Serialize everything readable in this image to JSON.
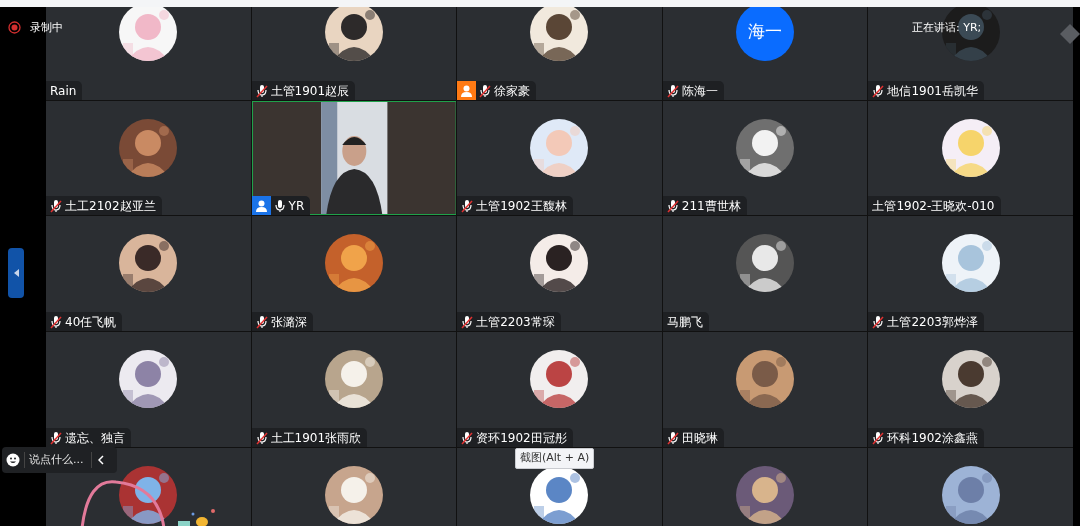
{
  "recording": {
    "label": "录制中"
  },
  "speaking": {
    "label": "正在讲话: YR;"
  },
  "rows": [
    {
      "tiles": [
        {
          "name": "Rain",
          "kind": "picture",
          "speaking": false
        },
        {
          "name": "土管1901赵辰",
          "muted": true,
          "kind": "picture",
          "speaking": false
        },
        {
          "name": "徐家豪",
          "muted": true,
          "kind": "picture",
          "color": "#ff7a14",
          "speaking": false
        },
        {
          "name": "陈海一",
          "muted": true,
          "kind": "initials",
          "initials": "海一",
          "speaking": false
        },
        {
          "name": "地信1901岳凯华",
          "muted": true,
          "kind": "picture",
          "speaking": false
        }
      ]
    },
    {
      "tiles": [
        {
          "name": "土工2102赵亚兰",
          "muted": true,
          "kind": "picture",
          "speaking": false
        },
        {
          "name": "YR",
          "muted": false,
          "kind": "video",
          "color": "#1a73e8",
          "speaking": true
        },
        {
          "name": "土管1902王馥林",
          "muted": true,
          "kind": "picture",
          "speaking": false
        },
        {
          "name": "211曹世林",
          "muted": true,
          "kind": "picture",
          "speaking": false
        },
        {
          "name": "土管1902-王晓欢-010",
          "kind": "picture",
          "speaking": false
        }
      ]
    },
    {
      "tiles": [
        {
          "name": "40任飞帆",
          "muted": true,
          "kind": "picture",
          "speaking": false
        },
        {
          "name": "张潞深",
          "muted": true,
          "kind": "picture",
          "speaking": false
        },
        {
          "name": "土管2203常琛",
          "muted": true,
          "kind": "picture",
          "speaking": false
        },
        {
          "name": "马鹏飞",
          "kind": "picture",
          "speaking": false
        },
        {
          "name": "土管2203郭烨泽",
          "muted": true,
          "kind": "picture",
          "speaking": false
        }
      ]
    },
    {
      "tiles": [
        {
          "name": "遗忘、独言",
          "muted": true,
          "kind": "picture",
          "speaking": false
        },
        {
          "name": "土工1901张雨欣",
          "muted": true,
          "kind": "picture",
          "speaking": false
        },
        {
          "name": "资环1902田冠彤",
          "muted": true,
          "kind": "picture",
          "speaking": false
        },
        {
          "name": "田晓琳",
          "muted": true,
          "kind": "picture",
          "speaking": false
        },
        {
          "name": "环科1902涂鑫燕",
          "muted": true,
          "kind": "picture",
          "speaking": false
        }
      ]
    },
    {
      "tiles": [
        {
          "kind": "picture",
          "speaking": false
        },
        {
          "kind": "picture",
          "speaking": false
        },
        {
          "kind": "picture",
          "speaking": false
        },
        {
          "kind": "picture",
          "speaking": false
        },
        {
          "kind": "picture",
          "speaking": false
        }
      ]
    }
  ],
  "chat": {
    "placeholder": "说点什么..."
  },
  "tooltip": {
    "label": "截图(Alt + A)"
  }
}
